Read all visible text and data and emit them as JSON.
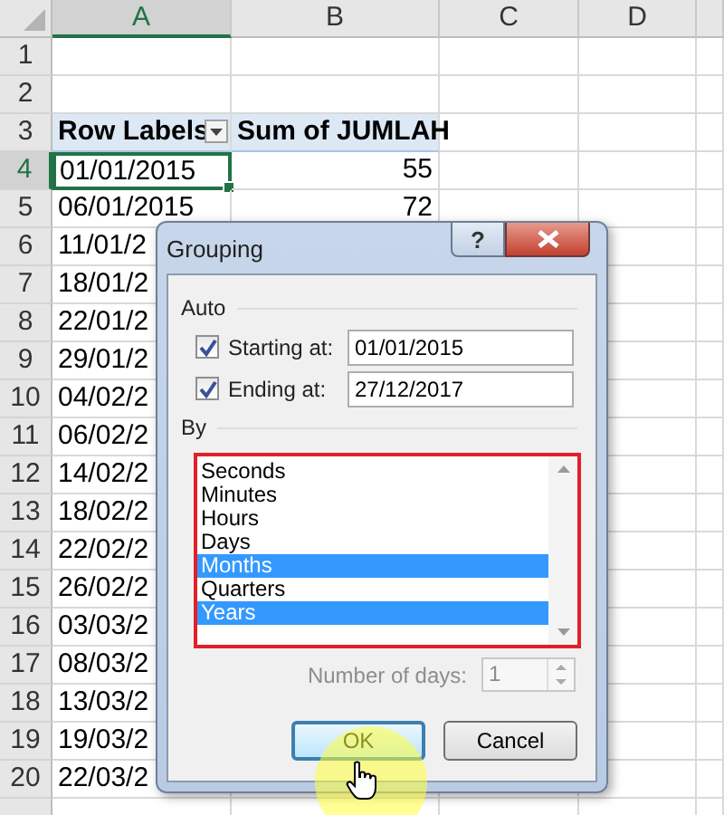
{
  "sheet": {
    "columns": [
      {
        "label": "A",
        "selected": true
      },
      {
        "label": "B",
        "selected": false
      },
      {
        "label": "C",
        "selected": false
      },
      {
        "label": "D",
        "selected": false
      }
    ],
    "rows": [
      {
        "number": "1",
        "selected": false
      },
      {
        "number": "2",
        "selected": false
      },
      {
        "number": "3",
        "selected": false,
        "cells": [
          {
            "text": "Row Labels",
            "kind": "header",
            "filter": true,
            "selected": false
          },
          {
            "text": "Sum of JUMLAH",
            "kind": "header",
            "selected": false
          }
        ]
      },
      {
        "number": "4",
        "selected": true,
        "cells": [
          {
            "text": "01/01/2015",
            "kind": "label",
            "selected": true
          },
          {
            "text": "55",
            "kind": "number",
            "selected": false
          }
        ]
      },
      {
        "number": "5",
        "selected": false,
        "cells": [
          {
            "text": "06/01/2015",
            "kind": "label",
            "selected": false
          },
          {
            "text": "72",
            "kind": "number",
            "selected": false
          }
        ]
      },
      {
        "number": "6",
        "selected": false,
        "cells": [
          {
            "text": "11/01/2",
            "kind": "label",
            "selected": false
          }
        ]
      },
      {
        "number": "7",
        "selected": false,
        "cells": [
          {
            "text": "18/01/2",
            "kind": "label",
            "selected": false
          }
        ]
      },
      {
        "number": "8",
        "selected": false,
        "cells": [
          {
            "text": "22/01/2",
            "kind": "label",
            "selected": false
          }
        ]
      },
      {
        "number": "9",
        "selected": false,
        "cells": [
          {
            "text": "29/01/2",
            "kind": "label",
            "selected": false
          }
        ]
      },
      {
        "number": "10",
        "selected": false,
        "cells": [
          {
            "text": "04/02/2",
            "kind": "label",
            "selected": false
          }
        ]
      },
      {
        "number": "11",
        "selected": false,
        "cells": [
          {
            "text": "06/02/2",
            "kind": "label",
            "selected": false
          }
        ]
      },
      {
        "number": "12",
        "selected": false,
        "cells": [
          {
            "text": "14/02/2",
            "kind": "label",
            "selected": false
          }
        ]
      },
      {
        "number": "13",
        "selected": false,
        "cells": [
          {
            "text": "18/02/2",
            "kind": "label",
            "selected": false
          }
        ]
      },
      {
        "number": "14",
        "selected": false,
        "cells": [
          {
            "text": "22/02/2",
            "kind": "label",
            "selected": false
          }
        ]
      },
      {
        "number": "15",
        "selected": false,
        "cells": [
          {
            "text": "26/02/2",
            "kind": "label",
            "selected": false
          }
        ]
      },
      {
        "number": "16",
        "selected": false,
        "cells": [
          {
            "text": "03/03/2",
            "kind": "label",
            "selected": false
          }
        ]
      },
      {
        "number": "17",
        "selected": false,
        "cells": [
          {
            "text": "08/03/2",
            "kind": "label",
            "selected": false
          }
        ]
      },
      {
        "number": "18",
        "selected": false,
        "cells": [
          {
            "text": "13/03/2",
            "kind": "label",
            "selected": false
          }
        ]
      },
      {
        "number": "19",
        "selected": false,
        "cells": [
          {
            "text": "19/03/2",
            "kind": "label",
            "selected": false
          }
        ]
      },
      {
        "number": "20",
        "selected": false,
        "cells": [
          {
            "text": "22/03/2",
            "kind": "label",
            "selected": false
          }
        ]
      }
    ]
  },
  "dialog": {
    "title": "Grouping",
    "help_button": {
      "label": "?"
    },
    "auto_group": {
      "label": "Auto",
      "fields": [
        {
          "label": "Starting at:",
          "checked": true,
          "value": "01/01/2015"
        },
        {
          "label": "Ending at:",
          "checked": true,
          "value": "27/12/2017"
        }
      ]
    },
    "by_group": {
      "label": "By",
      "highlighted": true,
      "items": [
        {
          "label": "Seconds",
          "selected": false
        },
        {
          "label": "Minutes",
          "selected": false
        },
        {
          "label": "Hours",
          "selected": false
        },
        {
          "label": "Days",
          "selected": false
        },
        {
          "label": "Months",
          "selected": true
        },
        {
          "label": "Quarters",
          "selected": false
        },
        {
          "label": "Years",
          "selected": true
        }
      ]
    },
    "number_of_days": {
      "label": "Number of days:",
      "value": "1",
      "disabled": true
    },
    "buttons": [
      {
        "label": "OK",
        "default": true
      },
      {
        "label": "Cancel",
        "default": false
      }
    ]
  },
  "cursor": {
    "highlighted": true
  }
}
